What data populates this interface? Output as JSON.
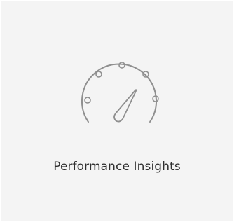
{
  "tile": {
    "label": "Performance Insights",
    "icon": "speedometer-icon"
  },
  "colors": {
    "tile_background": "#f4f4f4",
    "icon_stroke": "#8f8f8f",
    "label_text": "#2f2f2f"
  }
}
